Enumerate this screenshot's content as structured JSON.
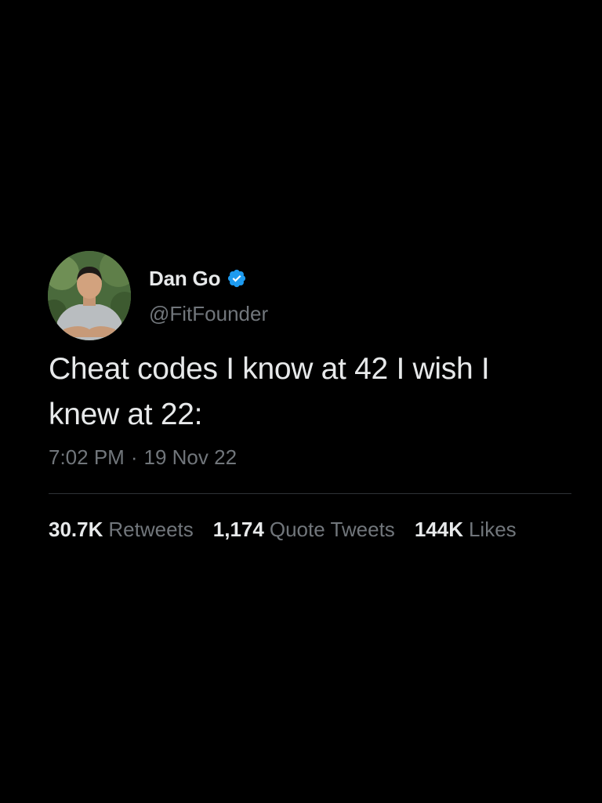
{
  "author": {
    "name": "Dan Go",
    "handle": "@FitFounder",
    "verified_icon": "verified-badge-icon",
    "verified_color": "#1d9bf0"
  },
  "tweet": {
    "text": "Cheat codes I know at 42 I wish I knew at 22:",
    "time": "7:02 PM",
    "separator": "·",
    "date": "19 Nov 22"
  },
  "stats": {
    "retweets": {
      "count": "30.7K",
      "label": "Retweets"
    },
    "quote_tweets": {
      "count": "1,174",
      "label": "Quote Tweets"
    },
    "likes": {
      "count": "144K",
      "label": "Likes"
    }
  },
  "colors": {
    "background": "#000000",
    "primary_text": "#e7e9ea",
    "secondary_text": "#71767b",
    "divider": "#2f3336"
  }
}
